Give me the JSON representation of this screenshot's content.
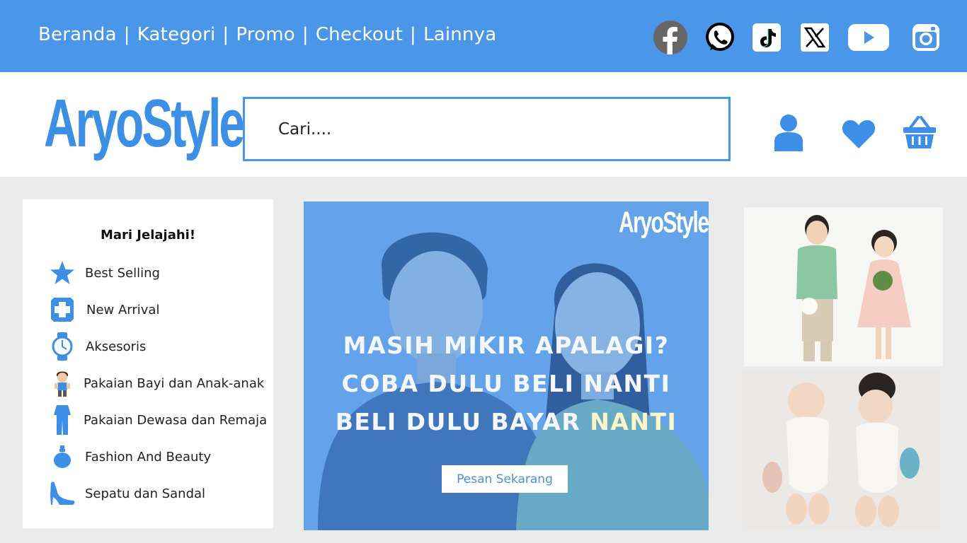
{
  "nav": {
    "items": [
      "Beranda",
      "Kategori",
      "Promo",
      "Checkout",
      "Lainnya"
    ],
    "separator": "|"
  },
  "socials": [
    {
      "icon": "facebook-icon"
    },
    {
      "icon": "whatsapp-icon"
    },
    {
      "icon": "tiktok-icon"
    },
    {
      "icon": "x-icon"
    },
    {
      "icon": "youtube-icon"
    },
    {
      "icon": "instagram-icon"
    }
  ],
  "brand": {
    "logo_text": "AryoStyle",
    "color": "#3d8fe6"
  },
  "search": {
    "placeholder": "Cari...."
  },
  "header_icons": [
    "user-icon",
    "heart-icon",
    "basket-icon"
  ],
  "sidebar": {
    "title": "Mari Jelajahi!",
    "items": [
      {
        "label": "Best Selling",
        "icon": "star-icon"
      },
      {
        "label": "New Arrival",
        "icon": "plus-badge-icon"
      },
      {
        "label": "Aksesoris",
        "icon": "watch-icon"
      },
      {
        "label": "Pakaian Bayi dan Anak-anak",
        "icon": "child-icon"
      },
      {
        "label": "Pakaian Dewasa dan Remaja",
        "icon": "jumpsuit-icon"
      },
      {
        "label": "Fashion And Beauty",
        "icon": "perfume-icon"
      },
      {
        "label": "Sepatu dan Sandal",
        "icon": "high-heel-icon"
      }
    ]
  },
  "hero": {
    "logo_text": "AryoStyle",
    "line1": "MASIH MIKIR APALAGI?",
    "line2": "COBA DULU BELI NANTI",
    "line3_a": "BELI DULU BAYAR ",
    "line3_b": "NANTI",
    "cta_label": "Pesan Sekarang"
  },
  "colors": {
    "primary": "#4a96e8",
    "background": "#ebebeb",
    "panel": "#ffffff"
  }
}
